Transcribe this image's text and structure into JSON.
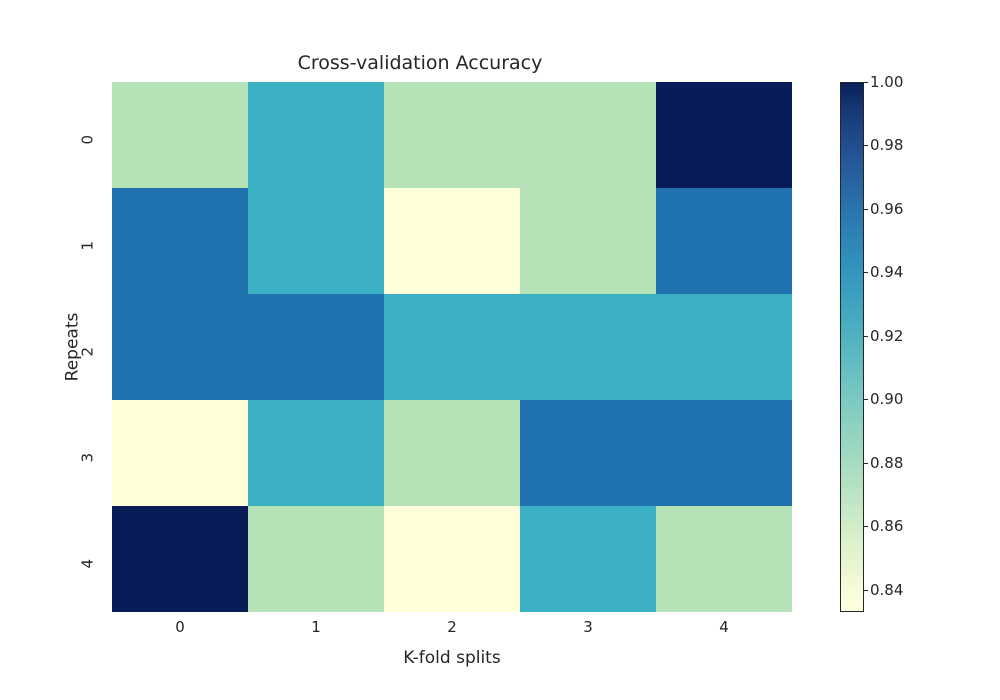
{
  "chart_data": {
    "type": "heatmap",
    "title": "Cross-validation Accuracy",
    "xlabel": "K-fold splits",
    "ylabel": "Repeats",
    "x_categories": [
      "0",
      "1",
      "2",
      "3",
      "4"
    ],
    "y_categories": [
      "0",
      "1",
      "2",
      "3",
      "4"
    ],
    "values": [
      [
        0.88,
        0.92,
        0.88,
        0.88,
        1.0
      ],
      [
        0.95,
        0.92,
        0.833,
        0.88,
        0.95
      ],
      [
        0.95,
        0.95,
        0.92,
        0.92,
        0.92
      ],
      [
        0.833,
        0.92,
        0.88,
        0.95,
        0.95
      ],
      [
        1.0,
        0.88,
        0.833,
        0.92,
        0.88
      ]
    ],
    "vmin": 0.833,
    "vmax": 1.0,
    "colormap": "YlGnBu",
    "colorbar_ticks": [
      "0.84",
      "0.86",
      "0.88",
      "0.90",
      "0.92",
      "0.94",
      "0.96",
      "0.98",
      "1.00"
    ]
  }
}
